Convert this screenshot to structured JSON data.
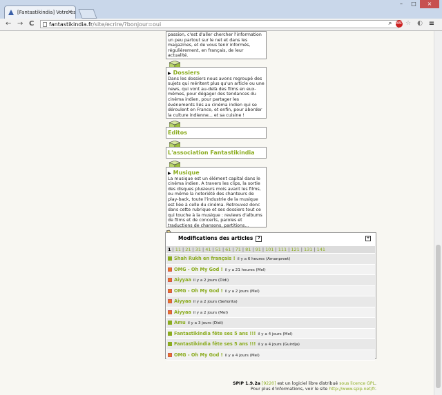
{
  "browser": {
    "tab_title": "[Fantastikindia] Votre esp",
    "tab_close": "×",
    "url_host": "fantastikindia.fr",
    "url_path": "/site/ecrire/?bonjour=oui",
    "nav_back": "←",
    "nav_forward": "→",
    "nav_reload": "C",
    "win_min": "–",
    "win_max": "□",
    "win_close": "×"
  },
  "sections": [
    {
      "title": "",
      "text": "passion, c'est d'aller chercher l'information un peu partout sur le net et dans les magazines, et de vous tenir informés, régulièrement, en français, de leur actualité."
    },
    {
      "title": "Dossiers",
      "text": "Dans les dossiers nous avons regroupé des sujets qui méritent plus qu'un article ou une news, qui vont au-delà des films en eux-mêmes, pour dégager des tendances du cinéma indien, pour partager les événements liés au cinéma indien qui se déroulent en France, et enfin, pour aborder la culture indienne... et sa cuisine !"
    },
    {
      "title": "Editos",
      "text": ""
    },
    {
      "title": "L'association Fantastikindia",
      "text": ""
    },
    {
      "title": "Musique",
      "text": "La musique est un élément capital dans le cinéma indien. A travers les clips, la sortie des disques plusieurs mois avant les films, ou même la notoriété des chanteurs de play-back, toute l'industrie de la musique est liée à celle du cinéma. Retrouvez donc dans cette rubrique et ses dossiers tout ce qui touche à la musique : reviews d'albums de films et de concerts, paroles et traductions de chansons, partitions..."
    }
  ],
  "modifications": {
    "title": "Modifications des articles",
    "help": "?",
    "expand": "+",
    "pager_current": "1",
    "pager_sep": "|",
    "pages": [
      "11",
      "21",
      "31",
      "41",
      "51",
      "61",
      "71",
      "81",
      "91",
      "101",
      "111",
      "121",
      "131",
      "141"
    ],
    "rows": [
      {
        "title": "Shah Rukh en français !",
        "meta": "il y a 6 heures (Amanpreet)",
        "marker": "green"
      },
      {
        "title": "OMG - Oh My God !",
        "meta": "il y a 21 heures (Mel)",
        "marker": "orange"
      },
      {
        "title": "Aiyyaa",
        "meta": "il y a 2 jours (Didi)",
        "marker": "orange"
      },
      {
        "title": "OMG - Oh My God !",
        "meta": "il y a 2 jours (Mel)",
        "marker": "orange"
      },
      {
        "title": "Aiyyaa",
        "meta": "il y a 2 jours (Señorita)",
        "marker": "orange"
      },
      {
        "title": "Aiyyaa",
        "meta": "il y a 2 jours (Mel)",
        "marker": "orange"
      },
      {
        "title": "Amu",
        "meta": "il y a 3 jours (Didi)",
        "marker": "green"
      },
      {
        "title": "Fantastikindia fête ses 5 ans !!!",
        "meta": "il y a 4 jours (Mel)",
        "marker": "green"
      },
      {
        "title": "Fantastikindia fête ses 5 ans !!!",
        "meta": "il y a 4 jours (Guirdja)",
        "marker": "green"
      },
      {
        "title": "OMG - Oh My God !",
        "meta": "il y a 4 jours (Mel)",
        "marker": "orange"
      }
    ]
  },
  "footer": {
    "version": "SPIP 1.9.2a",
    "rev": "[9220]",
    "line1_rest": " est un logiciel libre distribué ",
    "licence": "sous licence GPL",
    "line2": "Pour plus d'informations, voir le site ",
    "site": "http://www.spip.net/fr"
  },
  "colors": {
    "accent": "#8aab1e",
    "orange": "#e87a1e",
    "border": "#8e8e8e"
  }
}
